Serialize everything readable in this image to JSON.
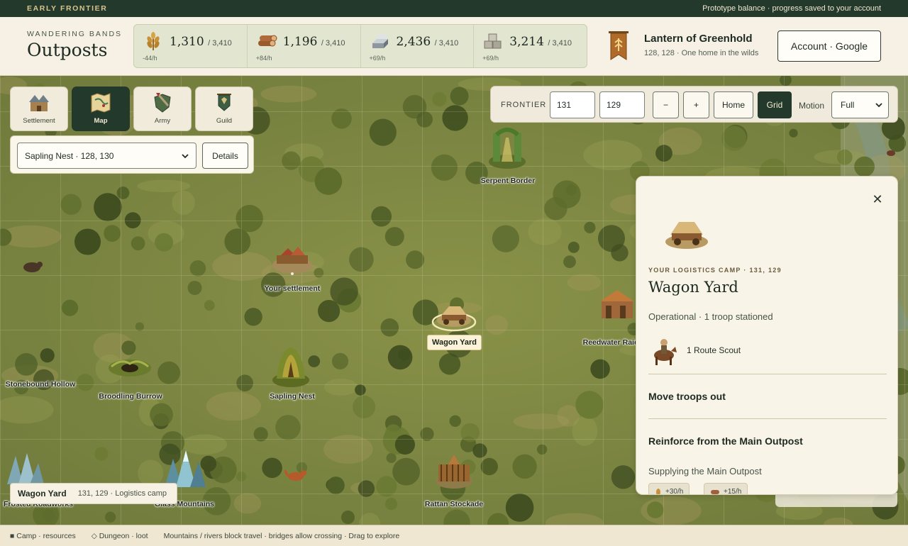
{
  "topstrip": {
    "brand": "EARLY FRONTIER",
    "note": "Prototype balance · progress saved to your account"
  },
  "header": {
    "kicker": "WANDERING BANDS",
    "title": "Outposts",
    "resources": [
      {
        "icon": "grain-icon",
        "value": "1,310",
        "cap": "/ 3,410",
        "rate": "-44/h"
      },
      {
        "icon": "wood-logs-icon",
        "value": "1,196",
        "cap": "/ 3,410",
        "rate": "+84/h"
      },
      {
        "icon": "iron-ingot-icon",
        "value": "2,436",
        "cap": "/ 3,410",
        "rate": "+69/h"
      },
      {
        "icon": "stone-blocks-icon",
        "value": "3,214",
        "cap": "/ 3,410",
        "rate": "+69/h"
      }
    ],
    "player_name": "Lantern of Greenhold",
    "player_sub": "128, 128 · One home in the wilds",
    "account_label": "Account · Google"
  },
  "tabs": [
    {
      "label": "Settlement",
      "icon": "settlement-icon",
      "active": false
    },
    {
      "label": "Map",
      "icon": "map-icon",
      "active": true
    },
    {
      "label": "Army",
      "icon": "army-shield-icon",
      "active": false
    },
    {
      "label": "Guild",
      "icon": "guild-banner-icon",
      "active": false
    }
  ],
  "nest": {
    "selected": "Sapling Nest · 128, 130",
    "details_label": "Details"
  },
  "frontier": {
    "label": "FRONTIER ·",
    "x": "131",
    "y": "129",
    "minus": "−",
    "plus": "+",
    "home": "Home",
    "grid": "Grid",
    "motion_label": "Motion",
    "motion_value": "Full"
  },
  "map": {
    "labels": {
      "serpent": "Serpent Border",
      "settlement": "Your settlement",
      "wagon": "Wagon Yard",
      "reedwater": "Reedwater Raid",
      "stonebound": "Stonebound Hollow",
      "broodling": "Broodling Burrow",
      "sapling": "Sapling Nest",
      "glass": "Glass Mountains",
      "rattan": "Rattan Stockade",
      "frosted": "Frosted Roadworks"
    }
  },
  "panel": {
    "kicker": "YOUR LOGISTICS CAMP · 131, 129",
    "title": "Wagon Yard",
    "status": "Operational · 1 troop stationed",
    "troop": "1 Route Scout",
    "move": "Move troops out",
    "reinforce": "Reinforce from the Main Outpost",
    "supply": "Supplying the Main Outpost",
    "chips": [
      "+30/h",
      "+15/h"
    ]
  },
  "info_chip": {
    "title": "Wagon Yard",
    "sub": "131, 129 · Logistics camp"
  },
  "footer": {
    "camp": "■ Camp · resources",
    "dungeon": "◇ Dungeon · loot",
    "hint": "Mountains / rivers block travel · bridges allow crossing · Drag to explore"
  },
  "colors": {
    "dark_green": "#23392c",
    "map_grass": "#7f8a45",
    "panel": "#f8f4e8"
  }
}
